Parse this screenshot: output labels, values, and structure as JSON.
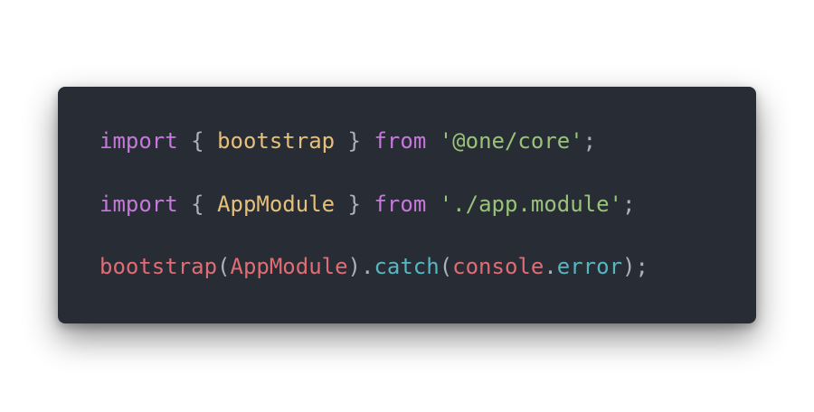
{
  "code": {
    "lines": [
      {
        "tokens": [
          {
            "text": "import",
            "kind": "keyword"
          },
          {
            "text": " { ",
            "kind": "punct"
          },
          {
            "text": "bootstrap",
            "kind": "ident"
          },
          {
            "text": " } ",
            "kind": "punct"
          },
          {
            "text": "from",
            "kind": "keyword"
          },
          {
            "text": " ",
            "kind": "punct"
          },
          {
            "text": "'@one/core'",
            "kind": "string"
          },
          {
            "text": ";",
            "kind": "punct"
          }
        ]
      },
      {
        "tokens": [
          {
            "text": "import",
            "kind": "keyword"
          },
          {
            "text": " { ",
            "kind": "punct"
          },
          {
            "text": "AppModule",
            "kind": "ident"
          },
          {
            "text": " } ",
            "kind": "punct"
          },
          {
            "text": "from",
            "kind": "keyword"
          },
          {
            "text": " ",
            "kind": "punct"
          },
          {
            "text": "'./app.module'",
            "kind": "string"
          },
          {
            "text": ";",
            "kind": "punct"
          }
        ]
      },
      {
        "tokens": [
          {
            "text": "bootstrap",
            "kind": "call"
          },
          {
            "text": "(",
            "kind": "punct"
          },
          {
            "text": "AppModule",
            "kind": "call"
          },
          {
            "text": ").",
            "kind": "punct"
          },
          {
            "text": "catch",
            "kind": "method"
          },
          {
            "text": "(",
            "kind": "punct"
          },
          {
            "text": "console",
            "kind": "call"
          },
          {
            "text": ".",
            "kind": "punct"
          },
          {
            "text": "error",
            "kind": "method"
          },
          {
            "text": ");",
            "kind": "punct"
          }
        ]
      }
    ]
  },
  "colors": {
    "background": "#282c34",
    "keyword": "#c678dd",
    "punct": "#abb2bf",
    "ident": "#e5c07b",
    "string": "#98c379",
    "call": "#e06c75",
    "method": "#56b6c2"
  }
}
